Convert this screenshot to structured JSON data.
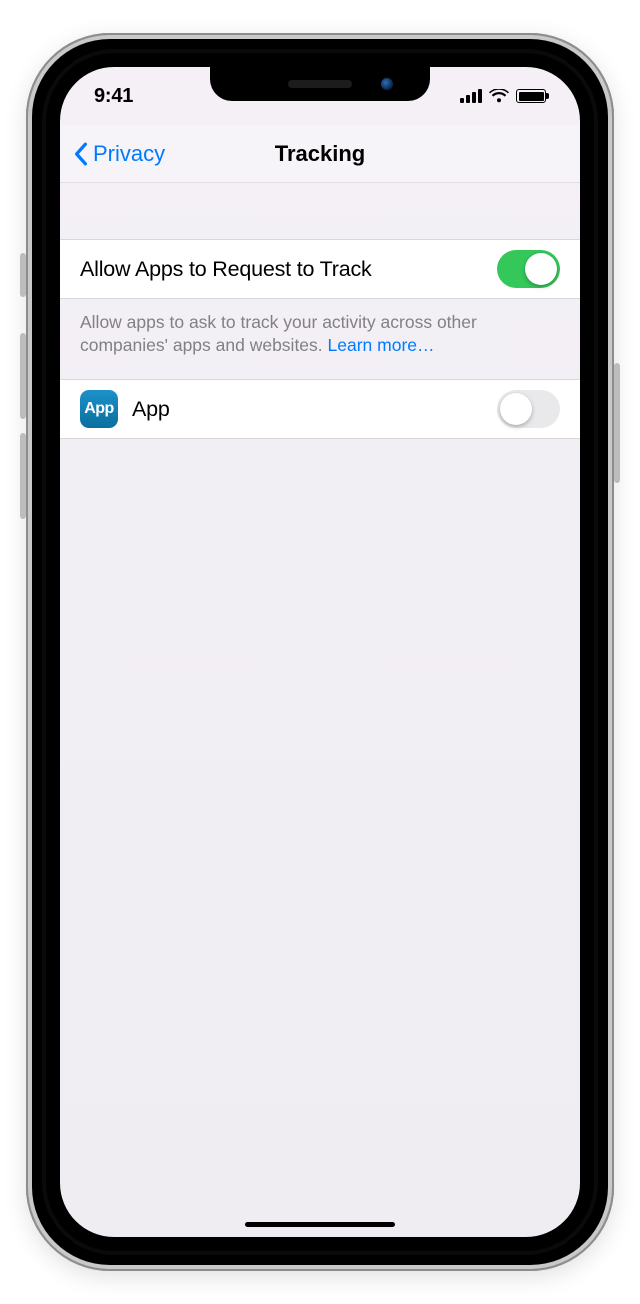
{
  "status": {
    "time": "9:41"
  },
  "nav": {
    "back_label": "Privacy",
    "title": "Tracking"
  },
  "settings": {
    "allow_request_label": "Allow Apps to Request to Track",
    "allow_request_on": true,
    "footer_text": "Allow apps to ask to track your activity across other companies' apps and websites. ",
    "learn_more_label": "Learn more…"
  },
  "apps": [
    {
      "name": "App",
      "icon_text": "App",
      "tracking_on": false
    }
  ]
}
